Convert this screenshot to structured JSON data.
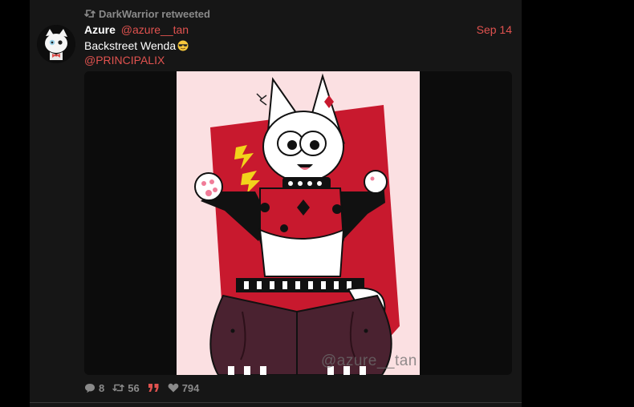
{
  "retweet": {
    "icon": "retweet-icon",
    "text": "DarkWarrior retweeted"
  },
  "tweet": {
    "avatar_icon": "avatar-cat-icon",
    "display_name": "Azure",
    "handle": "@azure__tan",
    "timestamp": "Sep 14",
    "text": "Backstreet Wenda",
    "emoji": "sunglasses-emoji",
    "mention": "@PRINCIPALIX",
    "media": {
      "watermark": "@azure__tan"
    },
    "actions": {
      "replies": "8",
      "retweets": "56",
      "likes": "794"
    }
  },
  "colors": {
    "accent": "#e0524f",
    "muted": "#8a8a8a",
    "timeline_bg": "#161616",
    "page_bg": "#000000",
    "text": "#ffffff"
  }
}
